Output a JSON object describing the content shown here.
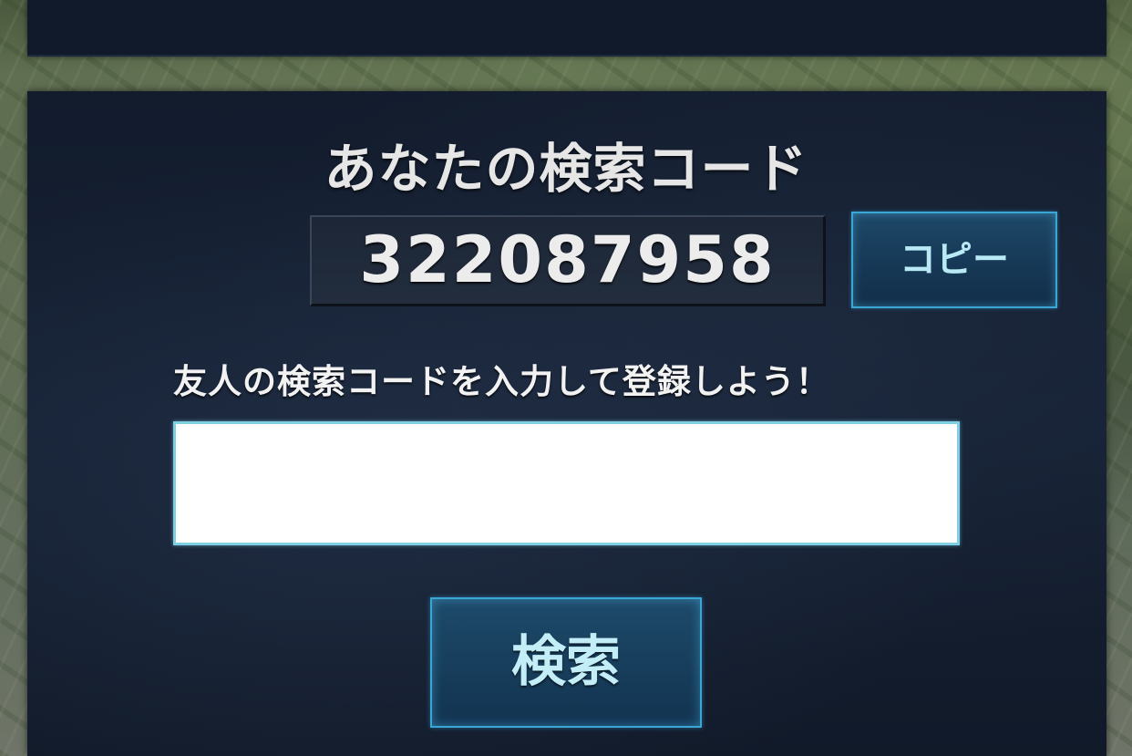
{
  "dialog": {
    "title": "あなたの検索コード",
    "my_code": "322087958",
    "copy_label": "コピー",
    "prompt": "友人の検索コードを入力して登録しよう！",
    "input_value": "",
    "search_label": "検索"
  }
}
